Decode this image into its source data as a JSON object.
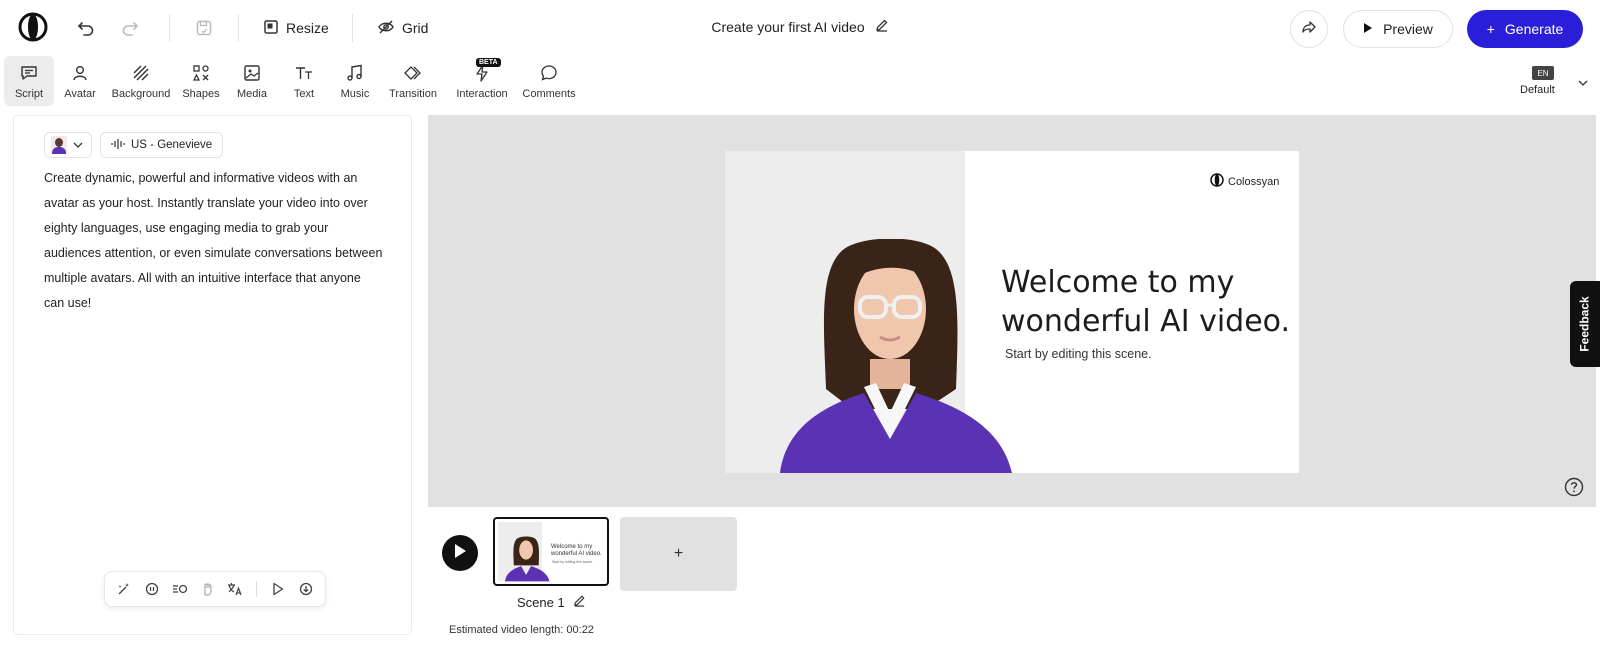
{
  "header": {
    "title": "Create your first AI video",
    "resize_label": "Resize",
    "grid_label": "Grid",
    "preview_label": "Preview",
    "generate_label": "Generate"
  },
  "tools": [
    {
      "label": "Script",
      "icon": "script-icon",
      "active": true
    },
    {
      "label": "Avatar",
      "icon": "avatar-icon"
    },
    {
      "label": "Background",
      "icon": "background-icon"
    },
    {
      "label": "Shapes",
      "icon": "shapes-icon"
    },
    {
      "label": "Media",
      "icon": "media-icon"
    },
    {
      "label": "Text",
      "icon": "text-icon"
    },
    {
      "label": "Music",
      "icon": "music-icon"
    },
    {
      "label": "Transition",
      "icon": "transition-icon"
    },
    {
      "label": "Interaction",
      "icon": "interaction-icon",
      "badge": "BETA"
    },
    {
      "label": "Comments",
      "icon": "comments-icon"
    }
  ],
  "language": {
    "code": "EN",
    "label": "Default"
  },
  "script": {
    "voice": "US - Genevieve",
    "text": "Create dynamic, powerful and informative videos with an avatar as your host. Instantly translate your video into over eighty languages, use engaging media to grab your audiences attention, or even simulate conversations between multiple avatars. All with an intuitive interface that anyone can use!"
  },
  "slide": {
    "brand": "Colossyan",
    "heading": "Welcome to my wonderful AI video.",
    "subheading": "Start by editing this scene."
  },
  "timeline": {
    "scene_name": "Scene 1",
    "add_label": "+",
    "estimated_length": "Estimated video length: 00:22"
  },
  "feedback_label": "Feedback",
  "colors": {
    "accent": "#2a1ed9",
    "sweater": "#5a32b3"
  }
}
